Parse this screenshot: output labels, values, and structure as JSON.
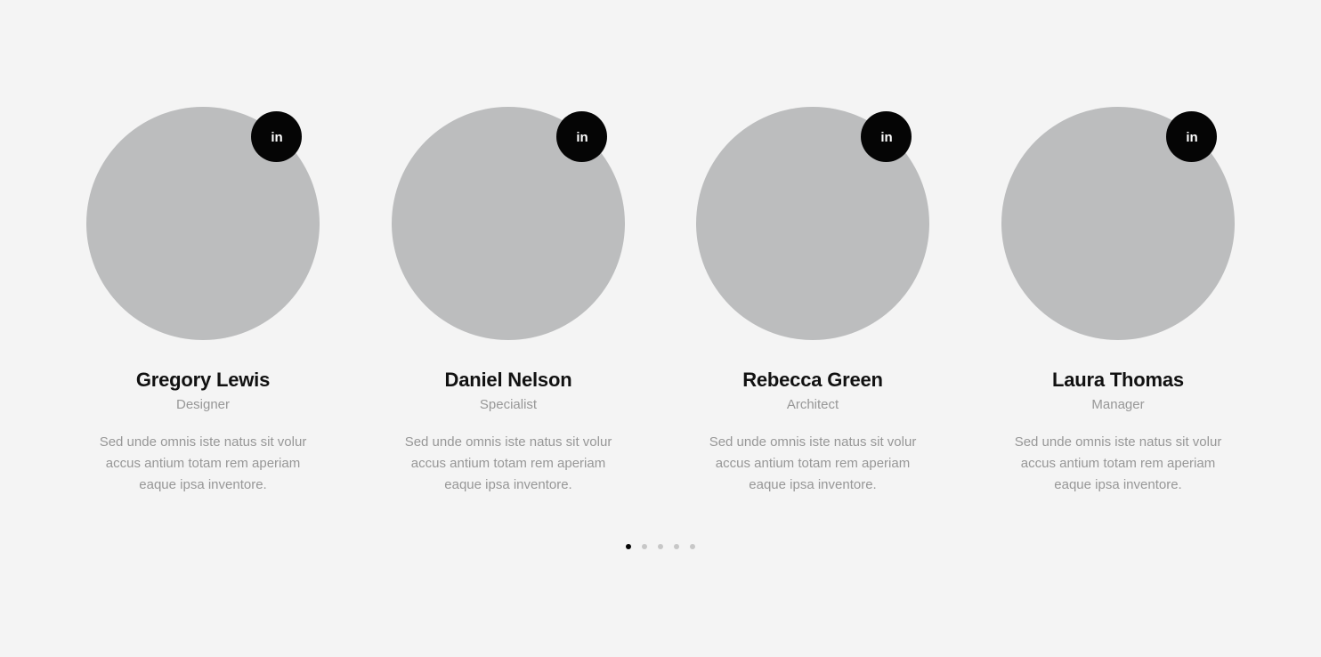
{
  "team": {
    "members": [
      {
        "name": "Gregory Lewis",
        "role": "Designer",
        "bio": "Sed unde omnis iste natus sit volur accus antium totam rem aperiam eaque ipsa inventore.",
        "social_icon": "linkedin-icon",
        "social_label": "in"
      },
      {
        "name": "Daniel Nelson",
        "role": "Specialist",
        "bio": "Sed unde omnis iste natus sit volur accus antium totam rem aperiam eaque ipsa inventore.",
        "social_icon": "linkedin-icon",
        "social_label": "in"
      },
      {
        "name": "Rebecca Green",
        "role": "Architect",
        "bio": "Sed unde omnis iste natus sit volur accus antium totam rem aperiam eaque ipsa inventore.",
        "social_icon": "linkedin-icon",
        "social_label": "in"
      },
      {
        "name": "Laura Thomas",
        "role": "Manager",
        "bio": "Sed unde omnis iste natus sit volur accus antium totam rem aperiam eaque ipsa inventore.",
        "social_icon": "linkedin-icon",
        "social_label": "in"
      }
    ]
  },
  "pagination": {
    "total_pages": 5,
    "active_page": 1
  },
  "colors": {
    "background": "#f4f4f4",
    "photo_placeholder": "#bcbdbe",
    "social_button": "#050505",
    "name_text": "#111111",
    "muted_text": "#979797",
    "dot_inactive": "#c7c7c7",
    "dot_active": "#050505"
  }
}
